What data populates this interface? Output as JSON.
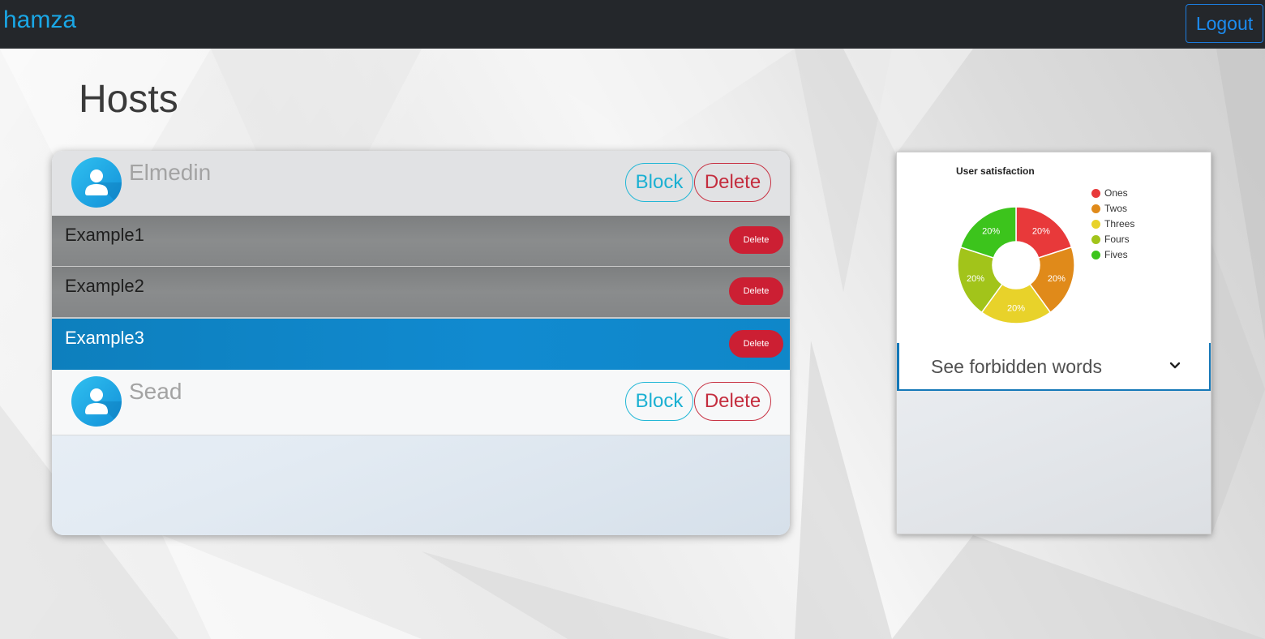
{
  "navbar": {
    "brand": "hamza",
    "logout_label": "Logout"
  },
  "page": {
    "title": "Hosts"
  },
  "hosts": [
    {
      "name": "Elmedin",
      "block_label": "Block",
      "delete_label": "Delete",
      "examples": [
        {
          "label": "Example1",
          "delete_label": "Delete",
          "active": false
        },
        {
          "label": "Example2",
          "delete_label": "Delete",
          "active": false
        },
        {
          "label": "Example3",
          "delete_label": "Delete",
          "active": true
        }
      ]
    },
    {
      "name": "Sead",
      "block_label": "Block",
      "delete_label": "Delete",
      "examples": []
    }
  ],
  "chart_data": {
    "type": "pie",
    "title": "User satisfaction",
    "donut": true,
    "legend_position": "right",
    "categories": [
      "Ones",
      "Twos",
      "Threes",
      "Fours",
      "Fives"
    ],
    "values": [
      20,
      20,
      20,
      20,
      20
    ],
    "labels": [
      "20%",
      "20%",
      "20%",
      "20%",
      "20%"
    ],
    "colors": [
      "#e8393a",
      "#e08a1a",
      "#e8d22a",
      "#a2c41a",
      "#3cc41c"
    ]
  },
  "forbidden_words": {
    "label": "See forbidden words",
    "icon": "chevron-down-icon"
  },
  "colors": {
    "navbar_bg": "#24272b",
    "brand": "#1aa7e6",
    "active_row": "#0f87c9",
    "delete_red": "#cc1f33",
    "block_cyan": "#1ab0d2"
  }
}
